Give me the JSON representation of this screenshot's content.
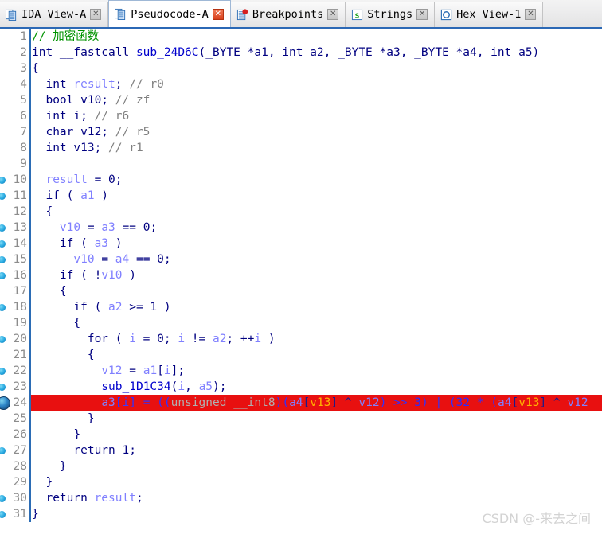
{
  "window": {
    "app": "IDA Pro",
    "active_view": "Pseudocode-A"
  },
  "tabs": [
    {
      "label": "IDA View-A",
      "icon": "document-pages-icon",
      "active": false,
      "close_label": "✕",
      "close_style": "gray"
    },
    {
      "label": "Pseudocode-A",
      "icon": "document-pages-icon",
      "active": true,
      "close_label": "✕",
      "close_style": "red"
    },
    {
      "label": "Breakpoints",
      "icon": "breakpoint-list-icon",
      "active": false,
      "close_label": "✕",
      "close_style": "gray"
    },
    {
      "label": "Strings",
      "icon": "strings-s-icon",
      "active": false,
      "close_label": "✕",
      "close_style": "gray"
    },
    {
      "label": "Hex View-1",
      "icon": "hex-circle-icon",
      "active": false,
      "close_label": "✕",
      "close_style": "gray"
    }
  ],
  "colors": {
    "comment": "#009300",
    "keyword": "#000080",
    "variable": "#8080ff",
    "function": "#0000cc",
    "highlight_bg": "#e81010",
    "gutter_text": "#8c8c8c",
    "divider": "#2b6cb5",
    "tabbar_underline": "#2b68b5",
    "watermark": "#d3d3d3"
  },
  "editor": {
    "first_line": 1,
    "last_line": 31,
    "current_line": 24,
    "marker_lines": [
      10,
      11,
      13,
      14,
      15,
      16,
      18,
      20,
      22,
      23,
      24,
      27,
      30,
      31
    ],
    "breakpoint_line": 24,
    "lines": [
      {
        "n": 1,
        "marker": false,
        "tokens": [
          {
            "t": "// 加密函数",
            "c": "t-cmt"
          }
        ]
      },
      {
        "n": 2,
        "marker": false,
        "tokens": [
          {
            "t": "int __fastcall ",
            "c": "t-kw"
          },
          {
            "t": "sub_24D6C",
            "c": "t-fn"
          },
          {
            "t": "(_BYTE *a1, int a2, _BYTE *a3, _BYTE *a4, int a5)",
            "c": "t-kw"
          }
        ]
      },
      {
        "n": 3,
        "marker": false,
        "tokens": [
          {
            "t": "{",
            "c": "t-punct"
          }
        ]
      },
      {
        "n": 4,
        "marker": false,
        "tokens": [
          {
            "t": "  int ",
            "c": "t-kw"
          },
          {
            "t": "result",
            "c": "t-var"
          },
          {
            "t": "; ",
            "c": "t-kw"
          },
          {
            "t": "// r0",
            "c": "t-gray"
          }
        ]
      },
      {
        "n": 5,
        "marker": false,
        "tokens": [
          {
            "t": "  bool v10; ",
            "c": "t-kw"
          },
          {
            "t": "// zf",
            "c": "t-gray"
          }
        ]
      },
      {
        "n": 6,
        "marker": false,
        "tokens": [
          {
            "t": "  int i; ",
            "c": "t-kw"
          },
          {
            "t": "// r6",
            "c": "t-gray"
          }
        ]
      },
      {
        "n": 7,
        "marker": false,
        "tokens": [
          {
            "t": "  char v12; ",
            "c": "t-kw"
          },
          {
            "t": "// r5",
            "c": "t-gray"
          }
        ]
      },
      {
        "n": 8,
        "marker": false,
        "tokens": [
          {
            "t": "  int v13; ",
            "c": "t-kw"
          },
          {
            "t": "// r1",
            "c": "t-gray"
          }
        ]
      },
      {
        "n": 9,
        "marker": false,
        "tokens": [
          {
            "t": "",
            "c": "t-kw"
          }
        ]
      },
      {
        "n": 10,
        "marker": true,
        "tokens": [
          {
            "t": "  ",
            "c": "t-kw"
          },
          {
            "t": "result",
            "c": "t-var"
          },
          {
            "t": " = 0;",
            "c": "t-kw"
          }
        ]
      },
      {
        "n": 11,
        "marker": true,
        "tokens": [
          {
            "t": "  if ( ",
            "c": "t-kw"
          },
          {
            "t": "a1",
            "c": "t-var"
          },
          {
            "t": " )",
            "c": "t-kw"
          }
        ]
      },
      {
        "n": 12,
        "marker": false,
        "tokens": [
          {
            "t": "  {",
            "c": "t-punct"
          }
        ]
      },
      {
        "n": 13,
        "marker": true,
        "tokens": [
          {
            "t": "    ",
            "c": "t-kw"
          },
          {
            "t": "v10",
            "c": "t-var"
          },
          {
            "t": " = ",
            "c": "t-kw"
          },
          {
            "t": "a3",
            "c": "t-var"
          },
          {
            "t": " == 0;",
            "c": "t-kw"
          }
        ]
      },
      {
        "n": 14,
        "marker": true,
        "tokens": [
          {
            "t": "    if ( ",
            "c": "t-kw"
          },
          {
            "t": "a3",
            "c": "t-var"
          },
          {
            "t": " )",
            "c": "t-kw"
          }
        ]
      },
      {
        "n": 15,
        "marker": true,
        "tokens": [
          {
            "t": "      ",
            "c": "t-kw"
          },
          {
            "t": "v10",
            "c": "t-var"
          },
          {
            "t": " = ",
            "c": "t-kw"
          },
          {
            "t": "a4",
            "c": "t-var"
          },
          {
            "t": " == 0;",
            "c": "t-kw"
          }
        ]
      },
      {
        "n": 16,
        "marker": true,
        "tokens": [
          {
            "t": "    if ( !",
            "c": "t-kw"
          },
          {
            "t": "v10",
            "c": "t-var"
          },
          {
            "t": " )",
            "c": "t-kw"
          }
        ]
      },
      {
        "n": 17,
        "marker": false,
        "tokens": [
          {
            "t": "    {",
            "c": "t-punct"
          }
        ]
      },
      {
        "n": 18,
        "marker": true,
        "tokens": [
          {
            "t": "      if ( ",
            "c": "t-kw"
          },
          {
            "t": "a2",
            "c": "t-var"
          },
          {
            "t": " >= 1 )",
            "c": "t-kw"
          }
        ]
      },
      {
        "n": 19,
        "marker": false,
        "tokens": [
          {
            "t": "      {",
            "c": "t-punct"
          }
        ]
      },
      {
        "n": 20,
        "marker": true,
        "tokens": [
          {
            "t": "        for ( ",
            "c": "t-kw"
          },
          {
            "t": "i",
            "c": "t-var"
          },
          {
            "t": " = 0; ",
            "c": "t-kw"
          },
          {
            "t": "i",
            "c": "t-var"
          },
          {
            "t": " != ",
            "c": "t-kw"
          },
          {
            "t": "a2",
            "c": "t-var"
          },
          {
            "t": "; ++",
            "c": "t-kw"
          },
          {
            "t": "i",
            "c": "t-var"
          },
          {
            "t": " )",
            "c": "t-kw"
          }
        ]
      },
      {
        "n": 21,
        "marker": false,
        "tokens": [
          {
            "t": "        {",
            "c": "t-punct"
          }
        ]
      },
      {
        "n": 22,
        "marker": true,
        "tokens": [
          {
            "t": "          ",
            "c": "t-kw"
          },
          {
            "t": "v12",
            "c": "t-var"
          },
          {
            "t": " = ",
            "c": "t-kw"
          },
          {
            "t": "a1",
            "c": "t-var"
          },
          {
            "t": "[",
            "c": "t-kw"
          },
          {
            "t": "i",
            "c": "t-var"
          },
          {
            "t": "];",
            "c": "t-kw"
          }
        ]
      },
      {
        "n": 23,
        "marker": true,
        "tokens": [
          {
            "t": "          ",
            "c": "t-kw"
          },
          {
            "t": "sub_1D1C34",
            "c": "t-fn"
          },
          {
            "t": "(",
            "c": "t-kw"
          },
          {
            "t": "i",
            "c": "t-var"
          },
          {
            "t": ", ",
            "c": "t-kw"
          },
          {
            "t": "a5",
            "c": "t-var"
          },
          {
            "t": ");",
            "c": "t-kw"
          }
        ]
      },
      {
        "n": 24,
        "marker": true,
        "highlight": true,
        "tokens": [
          {
            "t": "          ",
            "c": "h-punct"
          },
          {
            "t": "a3",
            "c": "h-var"
          },
          {
            "t": "[",
            "c": "h-punct"
          },
          {
            "t": "i",
            "c": "h-idx"
          },
          {
            "t": "] = ((",
            "c": "h-punct"
          },
          {
            "t": "unsigned __int8",
            "c": "h-gray"
          },
          {
            "t": ")(",
            "c": "h-punct"
          },
          {
            "t": "a4",
            "c": "h-var"
          },
          {
            "t": "[",
            "c": "h-dark"
          },
          {
            "t": "v13",
            "c": "h-orng"
          },
          {
            "t": "] ^ ",
            "c": "h-dark"
          },
          {
            "t": "v12",
            "c": "h-var"
          },
          {
            "t": ") >> ",
            "c": "h-punct"
          },
          {
            "t": "3",
            "c": "h-num"
          },
          {
            "t": ") | (",
            "c": "h-punct"
          },
          {
            "t": "32",
            "c": "h-num"
          },
          {
            "t": " * (",
            "c": "h-punct"
          },
          {
            "t": "a4",
            "c": "h-var"
          },
          {
            "t": "[",
            "c": "h-dark"
          },
          {
            "t": "v13",
            "c": "h-orng"
          },
          {
            "t": "] ^ ",
            "c": "h-dark"
          },
          {
            "t": "v12",
            "c": "h-var"
          }
        ]
      },
      {
        "n": 25,
        "marker": false,
        "tokens": [
          {
            "t": "        }",
            "c": "t-punct"
          }
        ]
      },
      {
        "n": 26,
        "marker": false,
        "tokens": [
          {
            "t": "      }",
            "c": "t-punct"
          }
        ]
      },
      {
        "n": 27,
        "marker": true,
        "tokens": [
          {
            "t": "      return 1;",
            "c": "t-kw"
          }
        ]
      },
      {
        "n": 28,
        "marker": false,
        "tokens": [
          {
            "t": "    }",
            "c": "t-punct"
          }
        ]
      },
      {
        "n": 29,
        "marker": false,
        "tokens": [
          {
            "t": "  }",
            "c": "t-punct"
          }
        ]
      },
      {
        "n": 30,
        "marker": true,
        "tokens": [
          {
            "t": "  return ",
            "c": "t-kw"
          },
          {
            "t": "result",
            "c": "t-var"
          },
          {
            "t": ";",
            "c": "t-kw"
          }
        ]
      },
      {
        "n": 31,
        "marker": true,
        "tokens": [
          {
            "t": "}",
            "c": "t-punct"
          }
        ]
      }
    ]
  },
  "watermark": {
    "text": "CSDN @-来去之间"
  }
}
